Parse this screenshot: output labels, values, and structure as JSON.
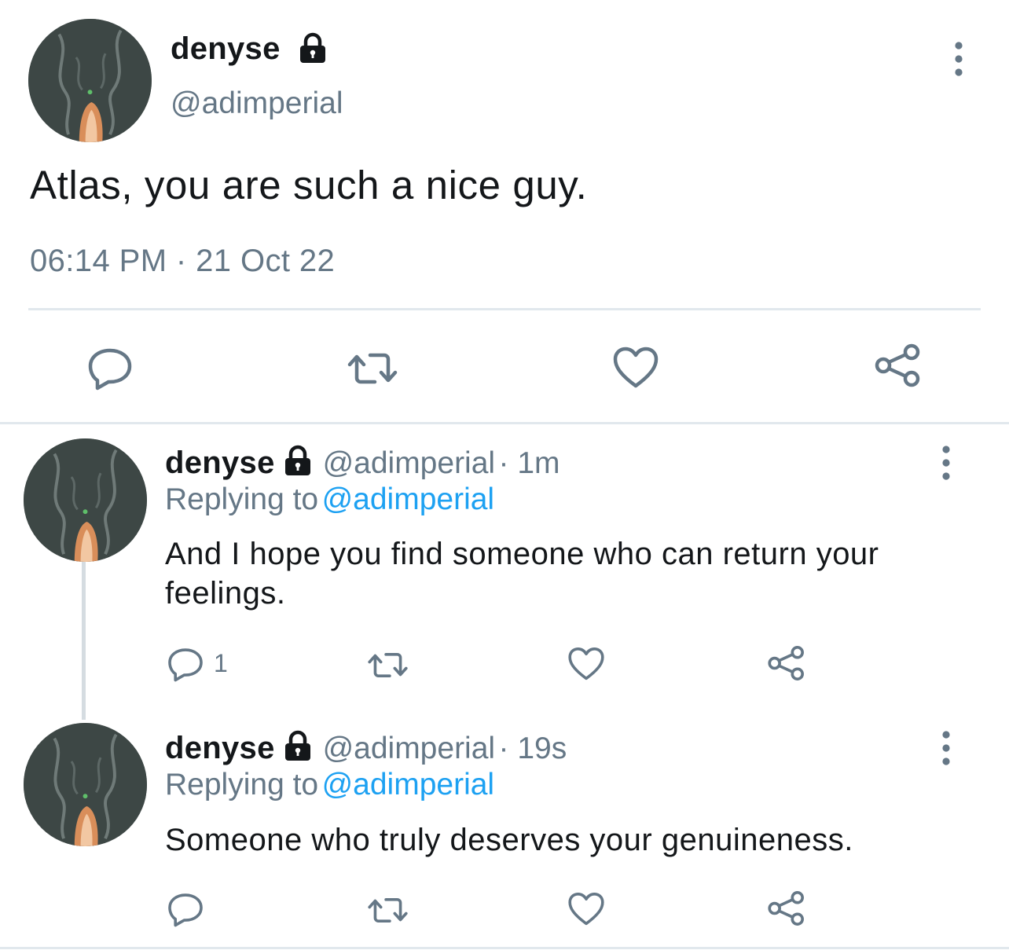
{
  "main_tweet": {
    "display_name": "denyse",
    "handle": "@adimperial",
    "text": "Atlas, you are such a nice guy.",
    "timestamp": "06:14 PM · 21 Oct 22",
    "icons": {
      "locked": "lock-icon",
      "more": "more-vertical-icon",
      "reply": "reply-icon",
      "retweet": "retweet-icon",
      "like": "heart-icon",
      "share": "share-icon"
    }
  },
  "replies": [
    {
      "display_name": "denyse",
      "handle": "@adimperial",
      "time_ago": "· 1m",
      "replying_prefix": "Replying to",
      "replying_to": "@adimperial",
      "text_line1": "And I hope you find someone who can return your",
      "text_line2": "feelings.",
      "reply_count": "1"
    },
    {
      "display_name": "denyse",
      "handle": "@adimperial",
      "time_ago": "· 19s",
      "replying_prefix": "Replying to",
      "replying_to": "@adimperial",
      "text_line1": "Someone who truly deserves your genuineness.",
      "reply_count": ""
    }
  ],
  "colors": {
    "text_primary": "#14171a",
    "text_secondary": "#657786",
    "link": "#1da1f2",
    "icon": "#657786",
    "divider": "#e1e8ed"
  }
}
